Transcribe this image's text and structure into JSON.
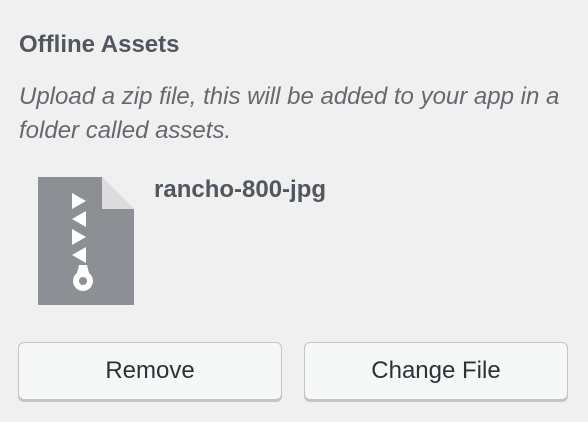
{
  "panel": {
    "title": "Offline Assets",
    "description": "Upload a zip file, this will be added to your app in a folder called assets."
  },
  "file": {
    "icon": "zip-archive-file-icon",
    "name": "rancho-800-jpg"
  },
  "actions": {
    "remove_label": "Remove",
    "change_label": "Change File"
  },
  "colors": {
    "background": "#f0f0f1",
    "text": "#50575e",
    "icon": "#8c8f94",
    "button_bg": "#f6f7f7",
    "button_border": "#c3c4c7"
  }
}
